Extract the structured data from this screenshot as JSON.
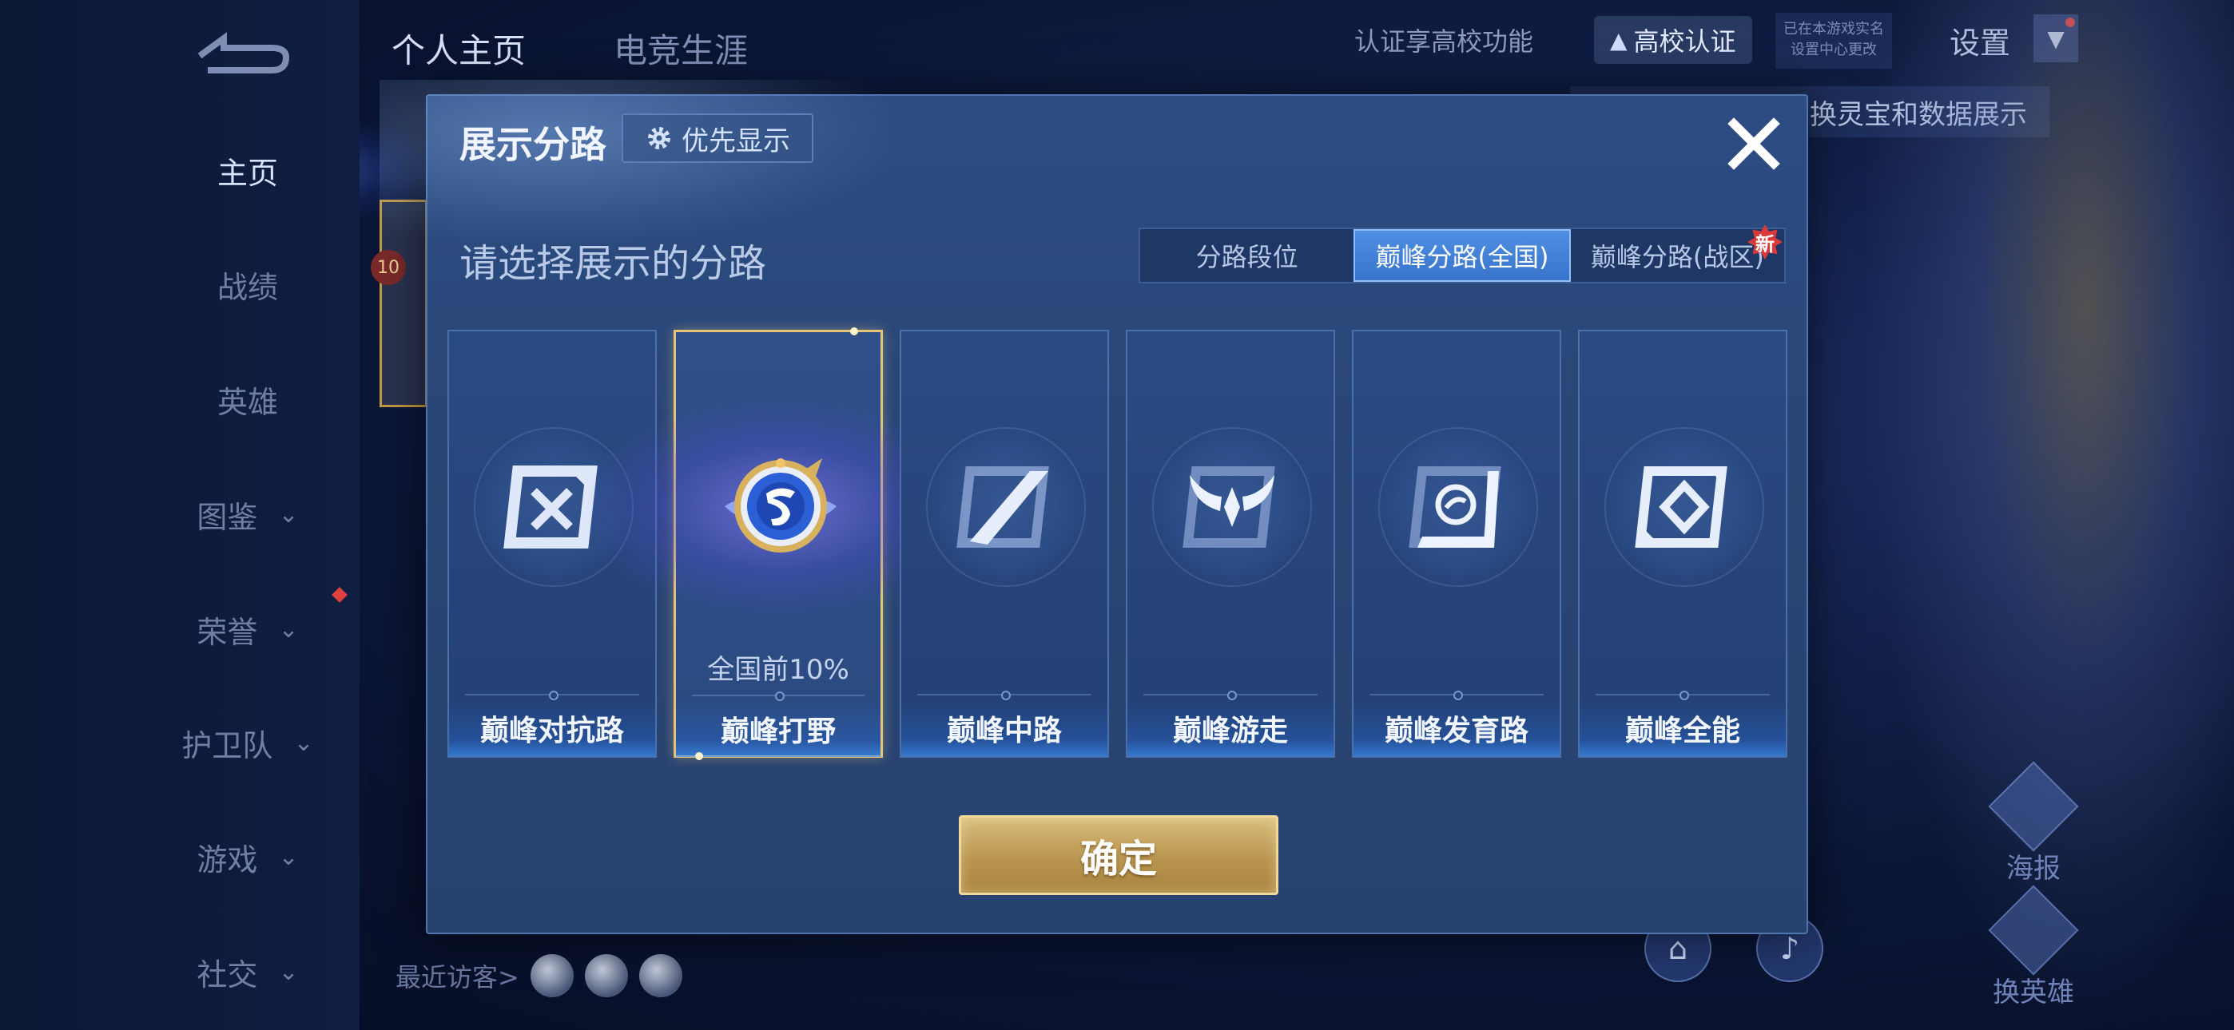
{
  "sidebar": {
    "items": [
      {
        "label": "主页",
        "active": true
      },
      {
        "label": "战绩"
      },
      {
        "label": "英雄"
      },
      {
        "label": "图鉴"
      },
      {
        "label": "荣誉"
      },
      {
        "label": "护卫队"
      },
      {
        "label": "游戏"
      },
      {
        "label": "社交"
      }
    ]
  },
  "top_tabs": [
    "个人主页",
    "电竞生涯"
  ],
  "top_right": {
    "cert_text": "认证享高校功能",
    "cert_badge": "高校认证",
    "small_badge": [
      "已在本游戏实名",
      "设置中心更改"
    ],
    "settings": "设置",
    "tip": "换灵宝和数据展示"
  },
  "right_buttons": [
    "海报",
    "换英雄"
  ],
  "level_badge": "10",
  "visitors_label": "最近访客>",
  "modal": {
    "title": "展示分路",
    "priority_button": "优先显示",
    "prompt": "请选择展示的分路",
    "segments": [
      {
        "label": "分路段位"
      },
      {
        "label": "巅峰分路(全国)",
        "selected": true
      },
      {
        "label": "巅峰分路(战区)",
        "new_tag": "新"
      }
    ],
    "cards": [
      {
        "label": "巅峰对抗路",
        "icon": "clash-lane-icon"
      },
      {
        "label": "巅峰打野",
        "icon": "jungle-icon",
        "rank": "全国前10%",
        "selected": true
      },
      {
        "label": "巅峰中路",
        "icon": "mid-lane-icon"
      },
      {
        "label": "巅峰游走",
        "icon": "roam-icon"
      },
      {
        "label": "巅峰发育路",
        "icon": "farm-lane-icon"
      },
      {
        "label": "巅峰全能",
        "icon": "all-round-icon"
      }
    ],
    "confirm": "确定"
  },
  "colors": {
    "modal_bg": "#2b4a80",
    "selected_border": "#e7c37a",
    "segment_selected": "#4a8ae0",
    "confirm_gold": "#c4a35e",
    "new_tag": "#d83a3a"
  }
}
